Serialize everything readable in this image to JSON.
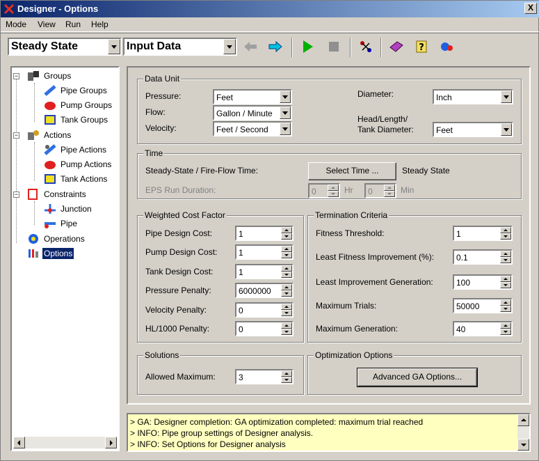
{
  "window": {
    "title": "Designer - Options",
    "close_label": "X"
  },
  "menu": [
    "Mode",
    "View",
    "Run",
    "Help"
  ],
  "toolbar": {
    "mode_value": "Steady State",
    "data_value": "Input Data"
  },
  "tree": {
    "groups": "Groups",
    "pipe_groups": "Pipe Groups",
    "pump_groups": "Pump Groups",
    "tank_groups": "Tank Groups",
    "actions": "Actions",
    "pipe_actions": "Pipe Actions",
    "pump_actions": "Pump Actions",
    "tank_actions": "Tank Actions",
    "constraints": "Constraints",
    "junction": "Junction",
    "pipe": "Pipe",
    "operations": "Operations",
    "options": "Options"
  },
  "data_unit": {
    "title": "Data Unit",
    "pressure_label": "Pressure:",
    "pressure_value": "Feet",
    "flow_label": "Flow:",
    "flow_value": "Gallon / Minute",
    "velocity_label": "Velocity:",
    "velocity_value": "Feet / Second",
    "diameter_label": "Diameter:",
    "diameter_value": "Inch",
    "head_label_1": "Head/Length/",
    "head_label_2": "Tank Diameter:",
    "head_value": "Feet"
  },
  "time": {
    "title": "Time",
    "steady_label": "Steady-State / Fire-Flow Time:",
    "select_button": "Select Time ...",
    "steady_value": "Steady State",
    "eps_label": "EPS Run Duration:",
    "hr_value": "0",
    "hr_label": "Hr",
    "min_value": "0",
    "min_label": "Min"
  },
  "cost": {
    "title": "Weighted Cost Factor",
    "rows": [
      {
        "label": "Pipe Design Cost:",
        "value": "1"
      },
      {
        "label": "Pump Design Cost:",
        "value": "1"
      },
      {
        "label": "Tank Design Cost:",
        "value": "1"
      },
      {
        "label": "Pressure Penalty:",
        "value": "6000000"
      },
      {
        "label": "Velocity Penalty:",
        "value": "0"
      },
      {
        "label": "HL/1000 Penalty:",
        "value": "0"
      }
    ]
  },
  "termination": {
    "title": "Termination Criteria",
    "rows": [
      {
        "label": "Fitness Threshold:",
        "value": "1"
      },
      {
        "label": "Least Fitness Improvement (%):",
        "value": "0.1"
      },
      {
        "label": "Least Improvement Generation:",
        "value": "100"
      },
      {
        "label": "Maximum Trials:",
        "value": "50000"
      },
      {
        "label": "Maximum Generation:",
        "value": "40"
      }
    ]
  },
  "solutions": {
    "title": "Solutions",
    "allowed_label": "Allowed Maximum:",
    "allowed_value": "3"
  },
  "optimization": {
    "title": "Optimization Options",
    "advanced_button": "Advanced GA Options..."
  },
  "log": [
    "> GA: Designer completion: GA optimization completed: maximum trial reached",
    "> INFO: Pipe group settings of Designer analysis.",
    "> INFO: Set Options for Designer analysis"
  ]
}
